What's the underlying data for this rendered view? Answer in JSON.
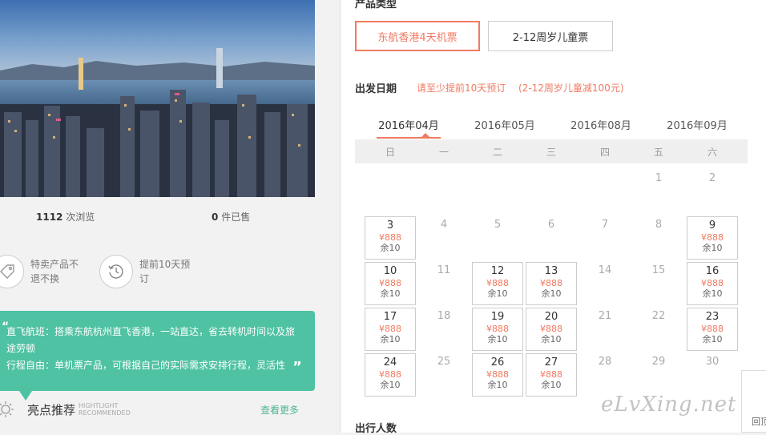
{
  "stats": {
    "views_count": "1112",
    "views_label": "次浏览",
    "sold_count": "0",
    "sold_label": "件已售"
  },
  "features": [
    {
      "icon": "tag-icon",
      "text": "特卖产品不退不换"
    },
    {
      "icon": "clock-history-icon",
      "text": "提前10天预订"
    }
  ],
  "highlight": {
    "quote_open": "“",
    "line1": "直飞航班：搭乘东航杭州直飞香港，一站直达，省去转机时间以及旅途劳顿",
    "line2": "行程自由：单机票产品，可根据自己的实际需求安排行程，灵活性",
    "quote_close": "”"
  },
  "recommend": {
    "title": "亮点推荐",
    "sub_en1": "HIGHTLIGHT",
    "sub_en2": "RECOMMENDED",
    "more": "查看更多"
  },
  "product_type": {
    "label": "产品类型",
    "options": [
      "东航香港4天机票",
      "2-12周岁儿童票"
    ],
    "selected": 0
  },
  "departure": {
    "label": "出发日期",
    "note1": "请至少提前10天预订",
    "note2": "(2-12周岁儿童减100元)"
  },
  "months": [
    "2016年04月",
    "2016年05月",
    "2016年08月",
    "2016年09月"
  ],
  "active_month": 0,
  "weekdays": [
    "日",
    "一",
    "二",
    "三",
    "四",
    "五",
    "六"
  ],
  "calendar": {
    "price": "¥888",
    "stock": "余10",
    "weeks": [
      [
        null,
        null,
        null,
        null,
        null,
        {
          "d": "1"
        },
        {
          "d": "2"
        }
      ],
      [
        {
          "d": "3",
          "a": true
        },
        {
          "d": "4"
        },
        {
          "d": "5"
        },
        {
          "d": "6"
        },
        {
          "d": "7"
        },
        {
          "d": "8"
        },
        {
          "d": "9",
          "a": true
        }
      ],
      [
        {
          "d": "10",
          "a": true
        },
        {
          "d": "11"
        },
        {
          "d": "12",
          "a": true
        },
        {
          "d": "13",
          "a": true
        },
        {
          "d": "14"
        },
        {
          "d": "15"
        },
        {
          "d": "16",
          "a": true
        }
      ],
      [
        {
          "d": "17",
          "a": true
        },
        {
          "d": "18"
        },
        {
          "d": "19",
          "a": true
        },
        {
          "d": "20",
          "a": true
        },
        {
          "d": "21"
        },
        {
          "d": "22"
        },
        {
          "d": "23",
          "a": true
        }
      ],
      [
        {
          "d": "24",
          "a": true
        },
        {
          "d": "25"
        },
        {
          "d": "26",
          "a": true
        },
        {
          "d": "27",
          "a": true
        },
        {
          "d": "28"
        },
        {
          "d": "29"
        },
        {
          "d": "30"
        }
      ]
    ]
  },
  "travelers_label": "出行人数",
  "watermark": "eLvXing.net",
  "back_top": "回顶"
}
